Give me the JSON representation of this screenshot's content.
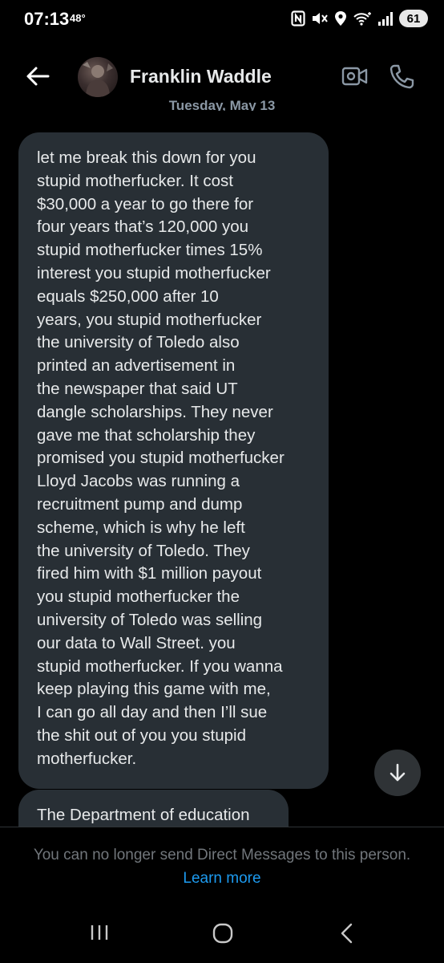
{
  "status_bar": {
    "time": "07:13",
    "temperature": "48°",
    "battery": "61",
    "icons": [
      "nfc-icon",
      "mute-icon",
      "location-icon",
      "wifi-icon",
      "signal-icon",
      "battery-icon"
    ]
  },
  "header": {
    "contact_name": "Franklin Waddle",
    "back_icon": "back-arrow-icon",
    "video_icon": "video-call-icon",
    "call_icon": "phone-icon"
  },
  "date_separator": "Tuesday, May 13",
  "messages": [
    {
      "lines": [
        "let me break this down for you",
        "stupid motherfucker. It cost",
        "$30,000 a year to go there for",
        "four years that’s 120,000 you",
        "stupid motherfucker times 15%",
        "interest you stupid motherfucker",
        "equals $250,000 after 10",
        "years, you stupid motherfucker",
        "the university of Toledo also",
        "printed an advertisement in",
        "the newspaper that said UT",
        "dangle scholarships. They never",
        "gave me that scholarship they",
        "promised you stupid motherfucker",
        "Lloyd Jacobs was running a",
        "recruitment pump and dump",
        "scheme, which is why he left",
        "the university of Toledo. They",
        "fired him with $1 million payout",
        "you stupid motherfucker the",
        "university of Toledo was selling",
        "our data to  Wall Street. you",
        "stupid motherfucker. If you wanna",
        "keep playing this game with me,",
        "I can go all day and then I’ll sue",
        "the shit out of you you stupid",
        "motherfucker."
      ]
    },
    {
      "lines": [
        "The Department of education"
      ]
    }
  ],
  "scroll_button_icon": "arrow-down-icon",
  "footer": {
    "notice": "You can no longer send Direct Messages to this person.",
    "link": "Learn more"
  },
  "nav_bar": {
    "icons": [
      "recents-icon",
      "home-icon",
      "back-icon"
    ]
  },
  "colors": {
    "background": "#000000",
    "bubble": "#282f35",
    "text": "#e7e9ea",
    "muted": "#71767b",
    "link": "#1d9bf0"
  }
}
